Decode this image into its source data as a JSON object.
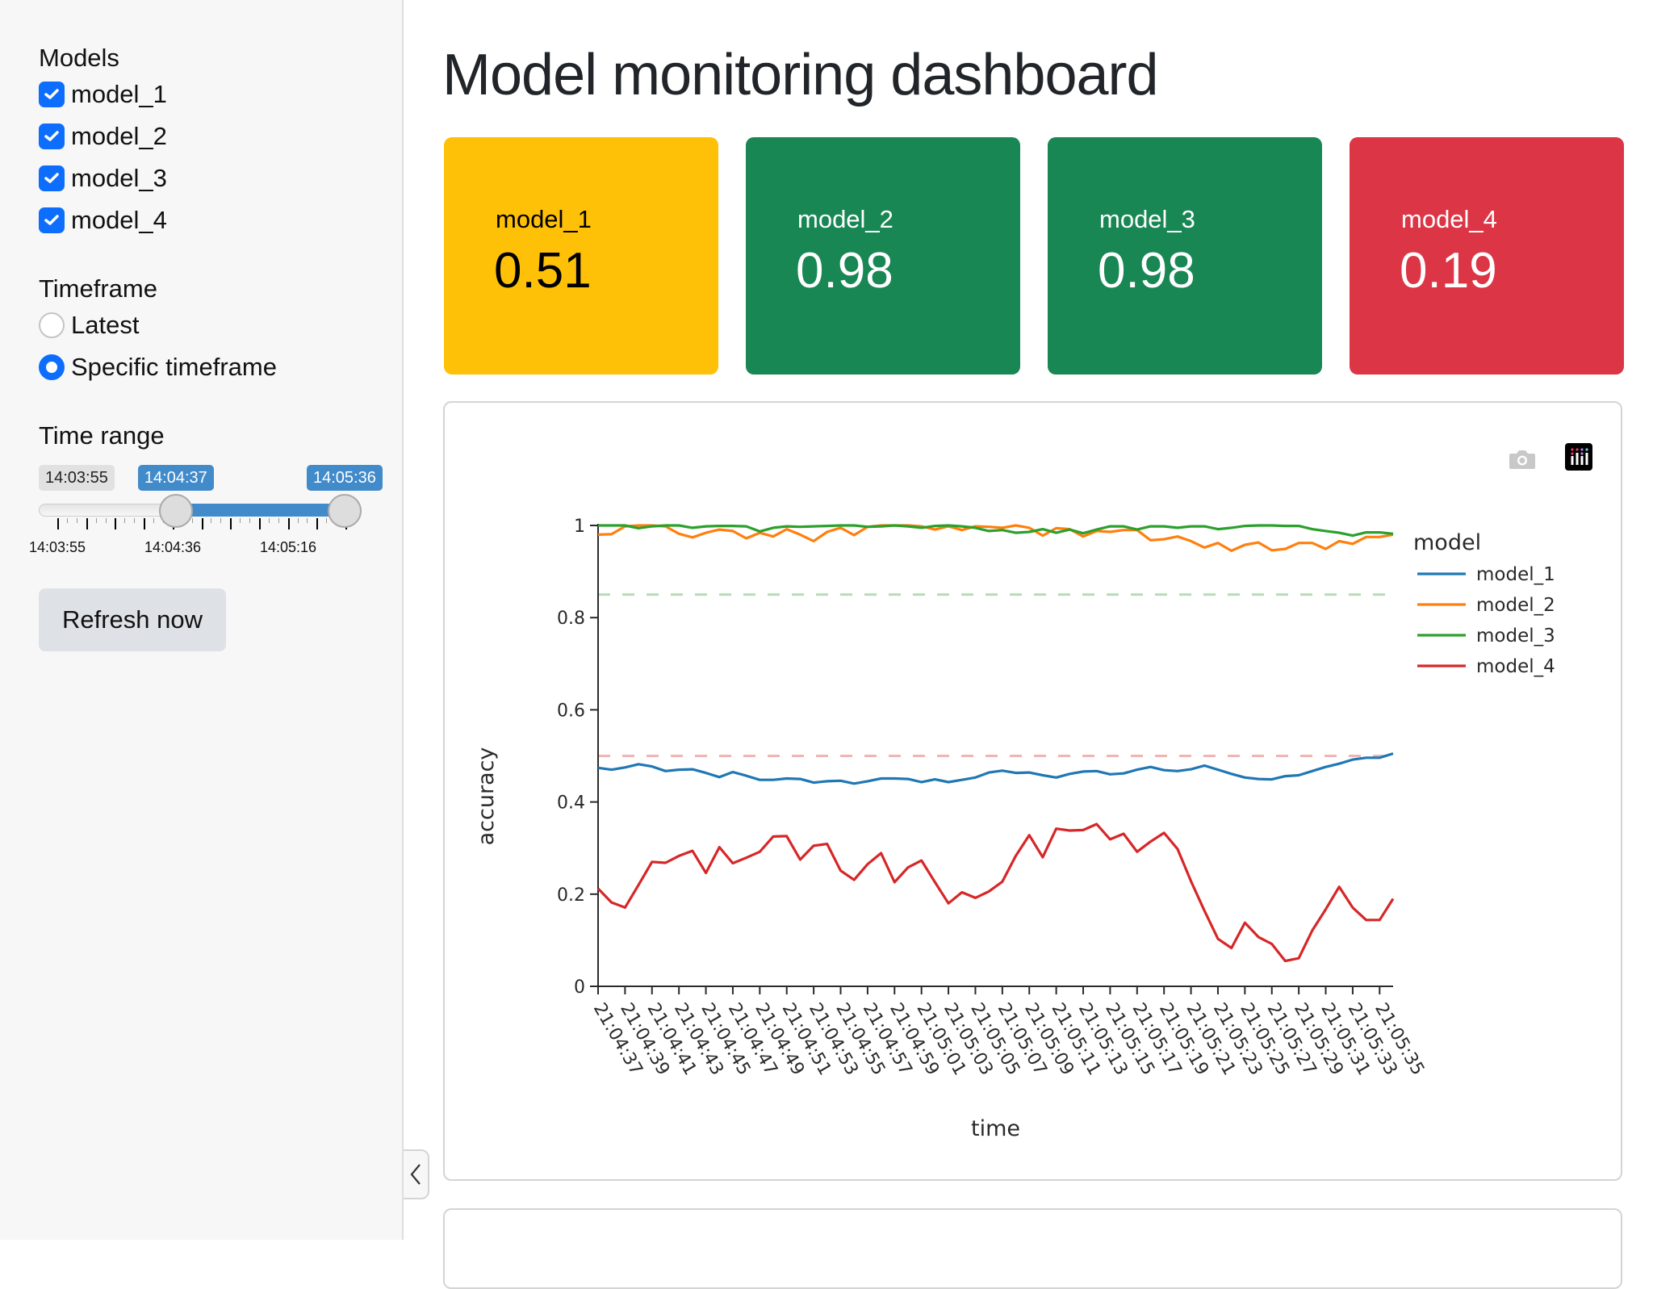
{
  "sidebar": {
    "models_label": "Models",
    "models": [
      {
        "label": "model_1",
        "checked": true
      },
      {
        "label": "model_2",
        "checked": true
      },
      {
        "label": "model_3",
        "checked": true
      },
      {
        "label": "model_4",
        "checked": true
      }
    ],
    "timeframe_label": "Timeframe",
    "timeframe_options": [
      {
        "label": "Latest",
        "selected": false
      },
      {
        "label": "Specific timeframe",
        "selected": true
      }
    ],
    "time_range_label": "Time range",
    "slider": {
      "min_label": "14:03:55",
      "from_label": "14:04:37",
      "to_label": "14:05:36",
      "from_fraction": 0.416,
      "to_fraction": 1.0,
      "tick_labels": [
        "14:03:55",
        "14:04:36",
        "14:05:16"
      ]
    },
    "refresh_label": "Refresh now",
    "collapse_icon": "chevron-left-icon"
  },
  "main": {
    "title": "Model monitoring dashboard",
    "kpis": [
      {
        "name": "model_1",
        "value": "0.51",
        "bg": "#ffc107",
        "fg": "#000000"
      },
      {
        "name": "model_2",
        "value": "0.98",
        "bg": "#198754",
        "fg": "#ffffff"
      },
      {
        "name": "model_3",
        "value": "0.98",
        "bg": "#198754",
        "fg": "#ffffff"
      },
      {
        "name": "model_4",
        "value": "0.19",
        "bg": "#dc3545",
        "fg": "#ffffff"
      }
    ],
    "modebar": {
      "camera_icon": "camera-icon",
      "logo_icon": "plotly-logo-icon"
    }
  },
  "chart_data": {
    "type": "line",
    "title": "",
    "xlabel": "time",
    "ylabel": "accuracy",
    "ylim": [
      0,
      1
    ],
    "yticks": [
      0,
      0.2,
      0.4,
      0.6,
      0.8,
      1
    ],
    "ytick_labels": [
      "0",
      "0.2",
      "0.4",
      "0.6",
      "0.8",
      "1"
    ],
    "x_start": "21:04:37",
    "x_step_seconds": 1,
    "xtick_labels": [
      "21:04:37",
      "21:04:39",
      "21:04:41",
      "21:04:43",
      "21:04:45",
      "21:04:47",
      "21:04:49",
      "21:04:51",
      "21:04:53",
      "21:04:55",
      "21:04:57",
      "21:04:59",
      "21:05:01",
      "21:05:03",
      "21:05:05",
      "21:05:07",
      "21:05:09",
      "21:05:11",
      "21:05:13",
      "21:05:15",
      "21:05:17",
      "21:05:19",
      "21:05:21",
      "21:05:23",
      "21:05:25",
      "21:05:27",
      "21:05:29",
      "21:05:31",
      "21:05:33",
      "21:05:35"
    ],
    "legend_title": "model",
    "legend_position": "right",
    "grid": false,
    "thresholds": [
      {
        "value": 0.85,
        "color": "#2ca02c",
        "style": "dashed"
      },
      {
        "value": 0.5,
        "color": "#d62728",
        "style": "dashed"
      }
    ],
    "series": [
      {
        "name": "model_1",
        "color": "#1f77b4",
        "values": [
          0.474,
          0.47,
          0.475,
          0.482,
          0.477,
          0.467,
          0.47,
          0.471,
          0.463,
          0.454,
          0.465,
          0.457,
          0.448,
          0.448,
          0.451,
          0.45,
          0.442,
          0.445,
          0.446,
          0.44,
          0.445,
          0.451,
          0.451,
          0.45,
          0.443,
          0.449,
          0.443,
          0.448,
          0.453,
          0.464,
          0.468,
          0.463,
          0.464,
          0.458,
          0.453,
          0.461,
          0.466,
          0.467,
          0.46,
          0.462,
          0.47,
          0.476,
          0.469,
          0.467,
          0.471,
          0.479,
          0.47,
          0.461,
          0.453,
          0.45,
          0.449,
          0.456,
          0.458,
          0.467,
          0.476,
          0.483,
          0.492,
          0.496,
          0.496,
          0.505
        ]
      },
      {
        "name": "model_2",
        "color": "#ff7f0e",
        "values": [
          0.98,
          0.981,
          0.998,
          1.0,
          1.0,
          0.998,
          0.982,
          0.974,
          0.984,
          0.991,
          0.988,
          0.972,
          0.984,
          0.976,
          0.992,
          0.98,
          0.966,
          0.986,
          0.995,
          0.979,
          0.997,
          1.0,
          1.0,
          1.0,
          0.998,
          0.991,
          0.998,
          0.99,
          0.998,
          0.997,
          0.995,
          1.0,
          0.995,
          0.978,
          0.994,
          0.992,
          0.976,
          0.988,
          0.986,
          0.99,
          0.99,
          0.968,
          0.97,
          0.976,
          0.966,
          0.952,
          0.962,
          0.945,
          0.958,
          0.963,
          0.946,
          0.949,
          0.962,
          0.962,
          0.949,
          0.966,
          0.96,
          0.975,
          0.975,
          0.98
        ]
      },
      {
        "name": "model_3",
        "color": "#2ca02c",
        "values": [
          1.0,
          1.0,
          1.0,
          0.994,
          0.998,
          1.0,
          1.0,
          0.995,
          0.998,
          0.999,
          0.999,
          0.998,
          0.987,
          0.995,
          0.998,
          0.997,
          0.998,
          0.999,
          1.0,
          1.0,
          0.997,
          0.998,
          1.0,
          0.998,
          0.995,
          0.999,
          1.0,
          0.998,
          0.995,
          0.988,
          0.99,
          0.984,
          0.986,
          0.992,
          0.984,
          0.991,
          0.983,
          0.991,
          0.998,
          0.998,
          0.991,
          0.998,
          0.998,
          0.995,
          0.998,
          0.998,
          0.992,
          0.995,
          0.999,
          1.0,
          1.0,
          0.999,
          0.999,
          0.992,
          0.988,
          0.984,
          0.978,
          0.985,
          0.985,
          0.982
        ]
      },
      {
        "name": "model_4",
        "color": "#d62728",
        "values": [
          0.212,
          0.182,
          0.171,
          0.22,
          0.27,
          0.268,
          0.283,
          0.294,
          0.246,
          0.302,
          0.267,
          0.279,
          0.292,
          0.325,
          0.326,
          0.275,
          0.305,
          0.309,
          0.251,
          0.231,
          0.265,
          0.289,
          0.226,
          0.258,
          0.273,
          0.226,
          0.18,
          0.204,
          0.192,
          0.206,
          0.227,
          0.283,
          0.328,
          0.28,
          0.342,
          0.338,
          0.339,
          0.352,
          0.319,
          0.331,
          0.292,
          0.314,
          0.333,
          0.298,
          0.228,
          0.164,
          0.103,
          0.083,
          0.138,
          0.107,
          0.092,
          0.055,
          0.061,
          0.121,
          0.167,
          0.216,
          0.171,
          0.144,
          0.144,
          0.19
        ]
      }
    ]
  }
}
